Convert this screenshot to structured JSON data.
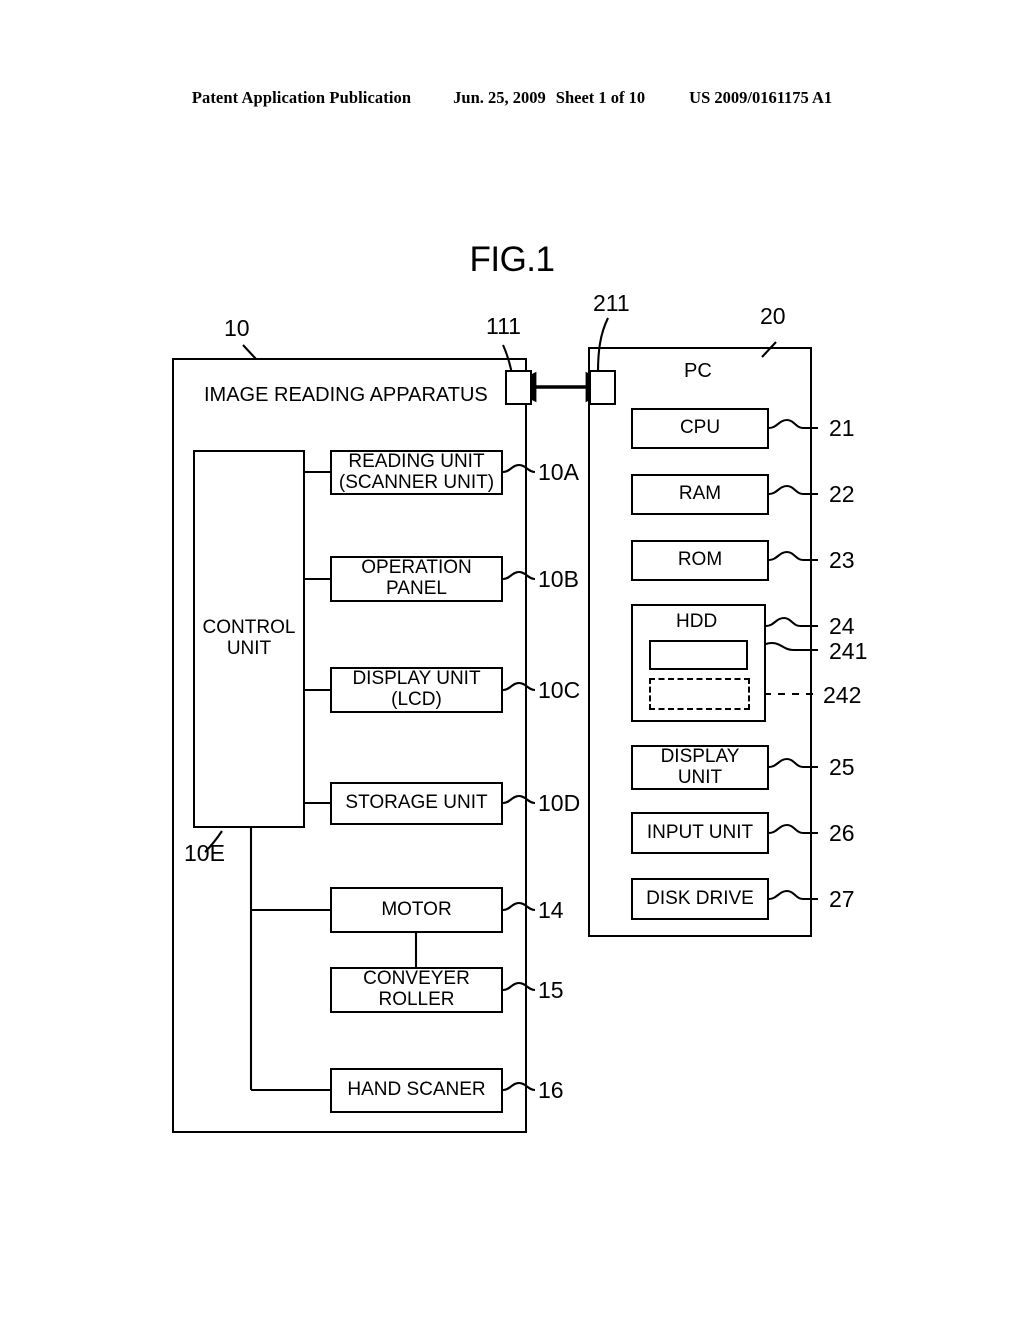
{
  "header": {
    "publication": "Patent Application Publication",
    "date": "Jun. 25, 2009",
    "sheet": "Sheet 1 of 10",
    "patent_number": "US 2009/0161175 A1"
  },
  "figure": {
    "title": "FIG.1"
  },
  "apparatus": {
    "ref": "10",
    "title": "IMAGE READING APPARATUS",
    "port_ref": "111",
    "control_unit": {
      "label": "CONTROL UNIT",
      "ref": "10E"
    },
    "blocks": [
      {
        "label": "READING UNIT\n(SCANNER UNIT)",
        "line1": "READING UNIT",
        "line2": "(SCANNER UNIT)",
        "ref": "10A"
      },
      {
        "label": "OPERATION\nPANEL",
        "line1": "OPERATION",
        "line2": "PANEL",
        "ref": "10B"
      },
      {
        "label": "DISPLAY UNIT\n(LCD)",
        "line1": "DISPLAY UNIT",
        "line2": "(LCD)",
        "ref": "10C"
      },
      {
        "label": "STORAGE UNIT",
        "line1": "STORAGE UNIT",
        "line2": "",
        "ref": "10D"
      },
      {
        "label": "MOTOR",
        "line1": "MOTOR",
        "line2": "",
        "ref": "14"
      },
      {
        "label": "CONVEYER\nROLLER",
        "line1": "CONVEYER",
        "line2": "ROLLER",
        "ref": "15"
      },
      {
        "label": "HAND SCANER",
        "line1": "HAND SCANER",
        "line2": "",
        "ref": "16"
      }
    ]
  },
  "pc": {
    "ref": "20",
    "title": "PC",
    "port_ref": "211",
    "blocks": [
      {
        "label": "CPU",
        "ref": "21"
      },
      {
        "label": "RAM",
        "ref": "22"
      },
      {
        "label": "ROM",
        "ref": "23"
      },
      {
        "label": "HDD",
        "ref": "24"
      }
    ],
    "hdd_inner": [
      {
        "label": "",
        "ref": "241",
        "style": "solid"
      },
      {
        "label": "",
        "ref": "242",
        "style": "dashed"
      }
    ],
    "lower_blocks": [
      {
        "line1": "DISPLAY",
        "line2": "UNIT",
        "ref": "25"
      },
      {
        "line1": "INPUT UNIT",
        "line2": "",
        "ref": "26"
      },
      {
        "line1": "DISK DRIVE",
        "line2": "",
        "ref": "27"
      }
    ]
  },
  "colors": {
    "ink": "#000000",
    "paper": "#ffffff"
  }
}
